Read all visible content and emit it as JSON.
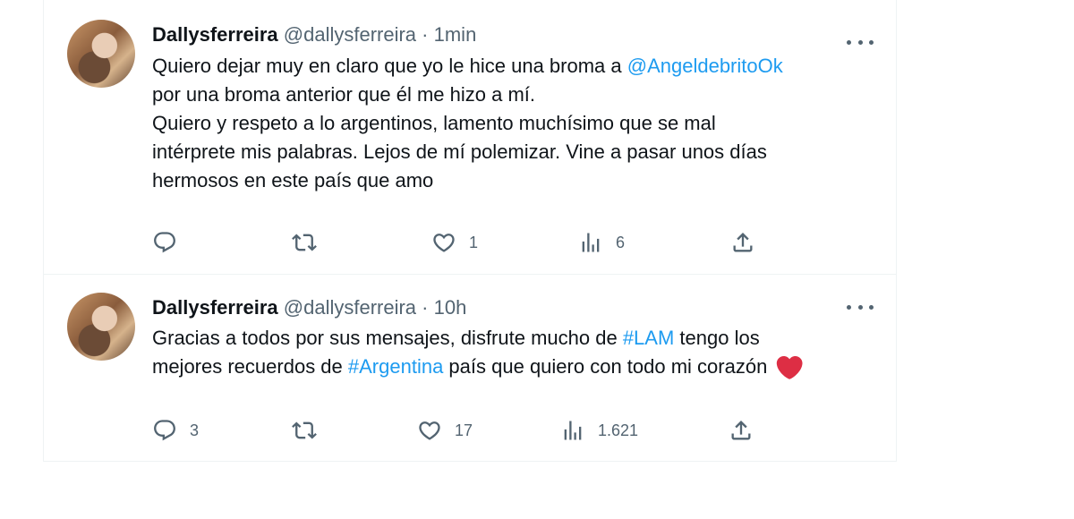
{
  "tweets": [
    {
      "name": "Dallysferreira",
      "handle": "@dallysferreira",
      "dot": "·",
      "time": "1min",
      "lines": [
        {
          "before": "Quiero dejar muy en claro que yo le hice una broma a ",
          "link": "@AngeldebritoOk",
          "after": ""
        },
        {
          "before": "por una broma anterior que él me hizo a mí.",
          "link": "",
          "after": ""
        },
        {
          "before": "Quiero y respeto a lo argentinos, lamento muchísimo que se mal",
          "link": "",
          "after": ""
        },
        {
          "before": "intérprete mis palabras. Lejos de mí polemizar. Vine a pasar unos días",
          "link": "",
          "after": ""
        },
        {
          "before": "hermosos en este país que amo",
          "link": "",
          "after": ""
        }
      ],
      "replies": "",
      "retweets": "",
      "likes": "1",
      "views": "6"
    },
    {
      "name": "Dallysferreira",
      "handle": "@dallysferreira",
      "dot": "·",
      "time": "10h",
      "lines": [
        {
          "before": "Gracias a todos por sus mensajes, disfrute mucho de ",
          "link": "#LAM",
          "after": " tengo los"
        },
        {
          "before": "mejores recuerdos de ",
          "link": "#Argentina",
          "after": " país que quiero con todo mi corazón "
        }
      ],
      "replies": "3",
      "retweets": "",
      "likes": "17",
      "views": "1.621"
    }
  ],
  "icons": {
    "reply": "reply-icon",
    "retweet": "retweet-icon",
    "like": "heart-icon",
    "views": "views-icon",
    "share": "share-icon",
    "more": "more-options-icon",
    "emoji": "red-heart-emoji"
  },
  "colors": {
    "link": "#1d9bf0",
    "secondary": "#536471",
    "text": "#0f1419",
    "emoji_heart": "#e0245e"
  }
}
